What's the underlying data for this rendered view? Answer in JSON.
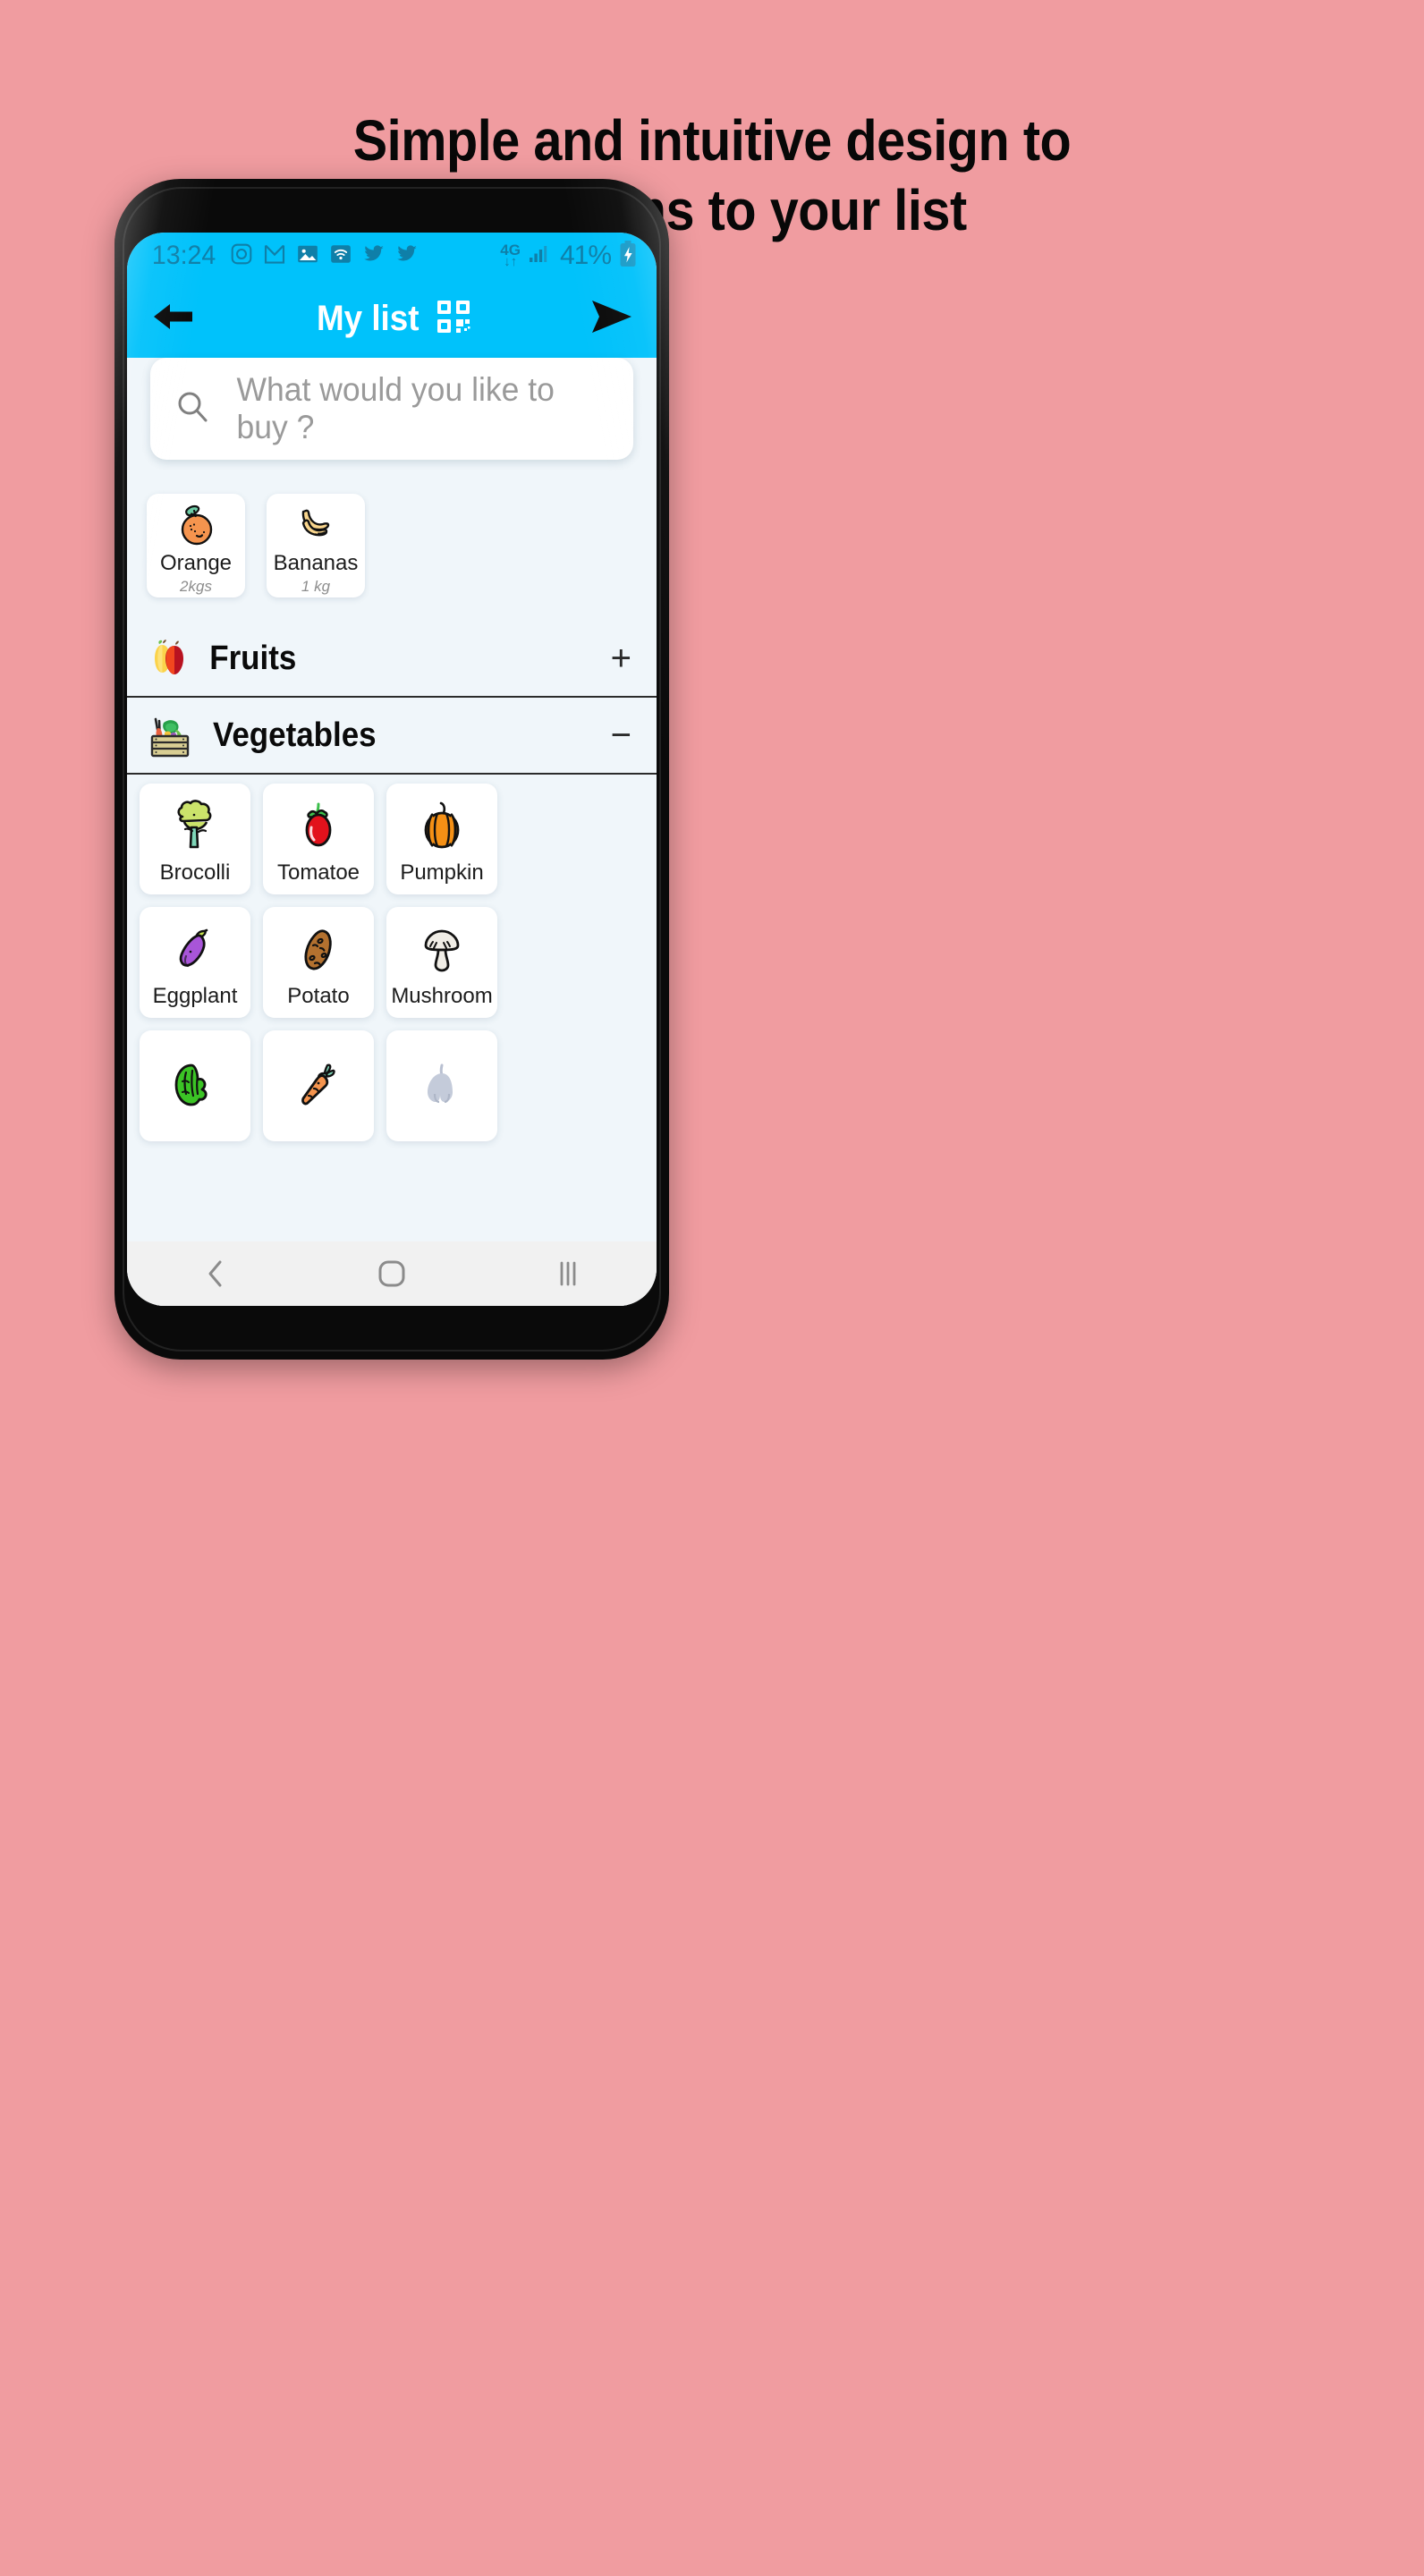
{
  "headline": {
    "line1": "Simple and intuitive design to",
    "line2": "add items to your list"
  },
  "colors": {
    "background_pink": "#F09CA0",
    "accent_cyan": "#00C2FB",
    "app_background": "#F0F6FA",
    "card_white": "#FFFFFF",
    "status_icon": "#0F7FA8",
    "nav_bar": "#F1F1F1"
  },
  "status_bar": {
    "time": "13:24",
    "left_icons": [
      "instagram-icon",
      "gmail-icon",
      "photos-icon",
      "wifi-icon",
      "twitter-icon",
      "twitter-icon"
    ],
    "network_label_top": "4G",
    "network_label_bottom": "↓↑",
    "signal": "signal-bars-icon",
    "battery_percent": "41%",
    "battery_icon": "battery-charging-icon"
  },
  "app_bar": {
    "back_icon": "back-arrow-icon",
    "title": "My list",
    "qr_icon": "qr-code-icon",
    "send_icon": "send-arrow-icon"
  },
  "search": {
    "icon": "search-icon",
    "placeholder": "What would you like to buy ?",
    "value": ""
  },
  "selected_items": [
    {
      "name": "Orange",
      "quantity": "2kgs",
      "icon": "orange-icon"
    },
    {
      "name": "Bananas",
      "quantity": "1 kg",
      "icon": "bananas-icon"
    }
  ],
  "sections": [
    {
      "label": "Fruits",
      "emoji": "pear-apple-icon",
      "toggle": "+",
      "expanded": false
    },
    {
      "label": "Vegetables",
      "emoji": "vegetable-crate-icon",
      "toggle": "−",
      "expanded": true
    }
  ],
  "vegetables": [
    {
      "name": "Brocolli",
      "icon": "broccoli-icon"
    },
    {
      "name": "Tomatoe",
      "icon": "tomato-icon"
    },
    {
      "name": "Pumpkin",
      "icon": "pumpkin-icon"
    },
    {
      "name": "Eggplant",
      "icon": "eggplant-icon"
    },
    {
      "name": "Potato",
      "icon": "potato-icon"
    },
    {
      "name": "Mushroom",
      "icon": "mushroom-icon"
    },
    {
      "name": "",
      "icon": "lettuce-icon"
    },
    {
      "name": "",
      "icon": "carrot-icon"
    },
    {
      "name": "",
      "icon": "garlic-icon"
    }
  ],
  "nav_bar": {
    "back": "nav-back-icon",
    "home": "nav-home-icon",
    "recents": "nav-recents-icon"
  }
}
